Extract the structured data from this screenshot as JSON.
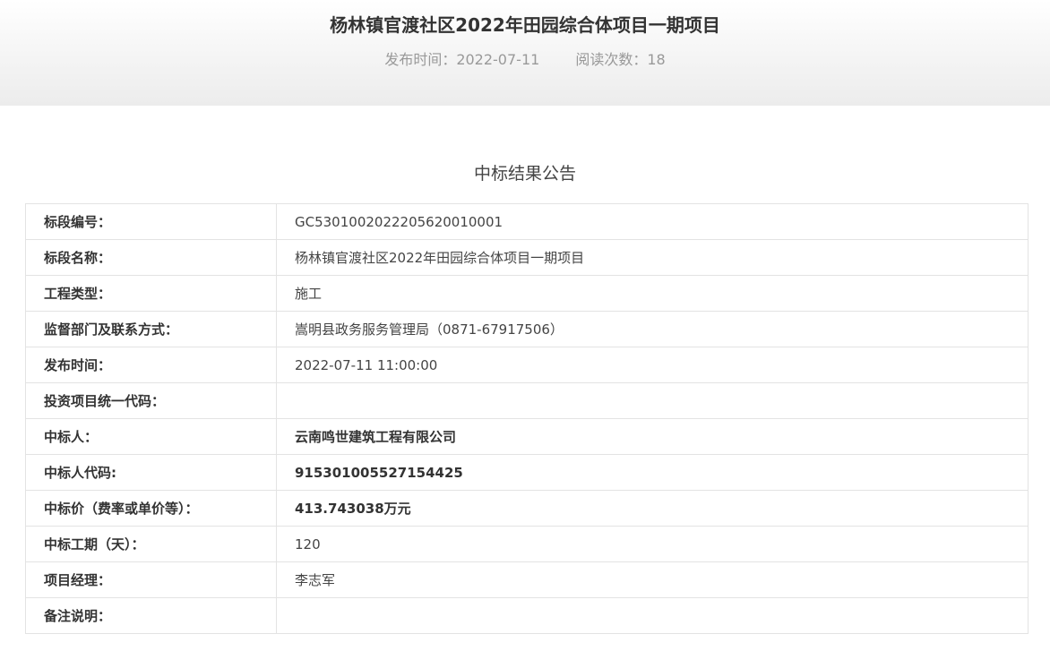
{
  "header": {
    "title": "杨林镇官渡社区2022年田园综合体项目一期项目",
    "publish_label": "发布时间：2022-07-11",
    "views_label": "阅读次数：18"
  },
  "notice": {
    "title": "中标结果公告"
  },
  "rows": [
    {
      "label": "标段编号：",
      "value": "GC5301002022205620010001"
    },
    {
      "label": "标段名称：",
      "value": "杨林镇官渡社区2022年田园综合体项目一期项目"
    },
    {
      "label": "工程类型：",
      "value": "施工"
    },
    {
      "label": "监督部门及联系方式：",
      "value": "嵩明县政务服务管理局（0871-67917506）"
    },
    {
      "label": "发布时间：",
      "value": "2022-07-11 11:00:00"
    },
    {
      "label": "投资项目统一代码：",
      "value": ""
    },
    {
      "label": "中标人：",
      "value": "云南鸣世建筑工程有限公司"
    },
    {
      "label": "中标人代码:",
      "value": "915301005527154425"
    },
    {
      "label": "中标价（费率或单价等）：",
      "value": "413.743038万元"
    },
    {
      "label": "中标工期（天）：",
      "value": "120"
    },
    {
      "label": "项目经理：",
      "value": "李志军"
    },
    {
      "label": "备注说明：",
      "value": ""
    }
  ]
}
